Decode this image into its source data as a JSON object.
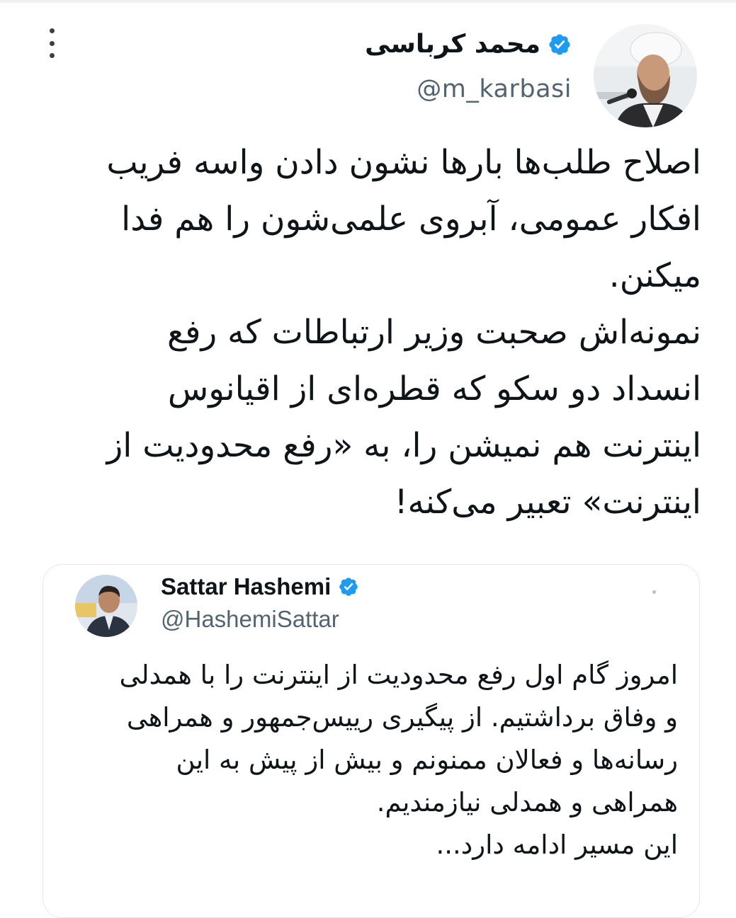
{
  "tweet": {
    "author": {
      "display_name": "محمد کرباسی",
      "handle": "@m_karbasi",
      "verified": true
    },
    "text_lines": [
      "اصلاح طلب‌ها بارها نشون دادن واسه فریب",
      "افکار عمومی، آبروی علمی‌شون را هم فدا",
      "میکنن.",
      "نمونه‌اش صحبت وزیر ارتباطات که رفع",
      "انسداد دو سکو که قطره‌ای از اقیانوس",
      "اینترنت هم نمیشن را، به «رفع محدودیت از",
      "اینترنت» تعبیر می‌کنه!"
    ],
    "more_icon": "more-vertical-icon"
  },
  "quoted_tweet": {
    "author": {
      "display_name": "Sattar Hashemi",
      "handle": "@HashemiSattar",
      "verified": true
    },
    "text_lines": [
      "امروز گام اول رفع محدودیت از اینترنت را با همدلی",
      "و وفاق برداشتیم. از پیگیری رییس‌جمهور و همراهی",
      "رسانه‌ها و فعالان ممنونم و بیش از پیش به این",
      "همراهی و همدلی نیازمندیم.",
      "این مسیر ادامه دارد..."
    ]
  },
  "colors": {
    "text_primary": "#0f1419",
    "text_secondary": "#536471",
    "verified_blue": "#1d9bf0",
    "border": "#e4e8eb"
  }
}
